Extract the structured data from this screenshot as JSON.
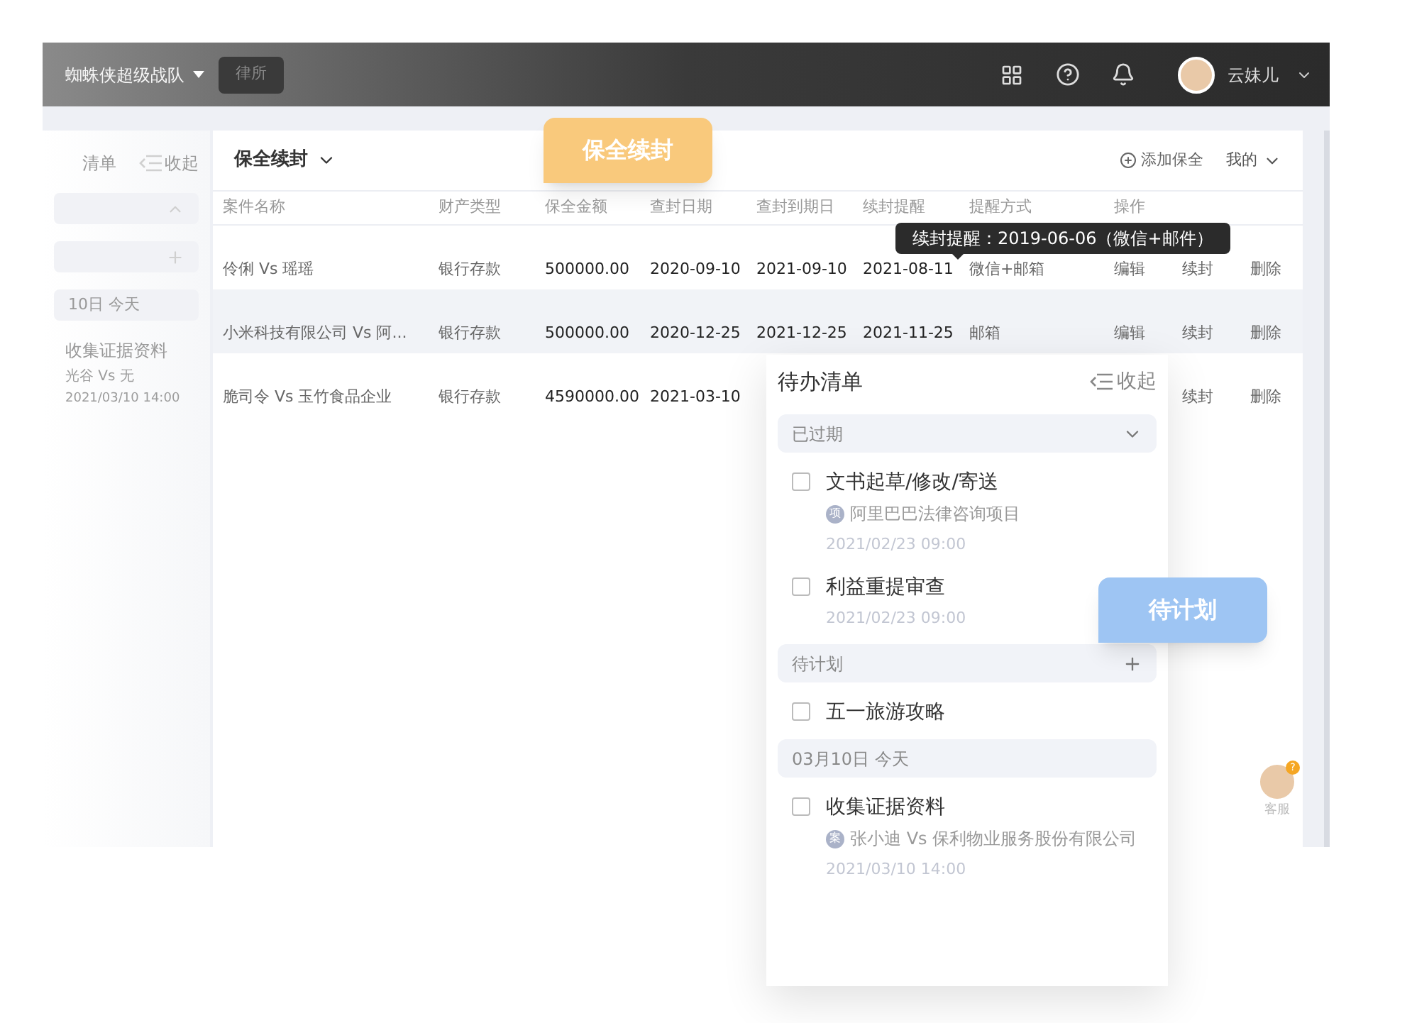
{
  "header": {
    "team": "蜘蛛侠超级战队",
    "team_tab": "律所",
    "user": "云妹儿"
  },
  "sidebar": {
    "title": "清单",
    "collapse": "收起",
    "sections": [
      {
        "kind": "expanded"
      },
      {
        "kind": "add"
      },
      {
        "kind": "plain",
        "label": "10日 今天"
      }
    ],
    "item": {
      "title": "收集证据资料",
      "project": "光谷 Vs 无",
      "time": "2021/03/10 14:00"
    }
  },
  "main": {
    "title": "保全续封",
    "add": "添加保全",
    "filter": "我的",
    "columns": [
      "案件名称",
      "财产类型",
      "保全金额",
      "查封日期",
      "查封到期日",
      "续封提醒",
      "提醒方式",
      "操作"
    ],
    "rows": [
      {
        "hovered": false,
        "cells": [
          "伶俐 Vs 瑶瑶",
          "银行存款",
          "500000.00",
          "2020-09-10",
          "2021-09-10",
          "2021-08-11",
          "微信+邮箱"
        ],
        "actions": [
          "编辑",
          "续封",
          "删除"
        ]
      },
      {
        "hovered": true,
        "cells": [
          "小米科技有限公司 Vs 阿...",
          "银行存款",
          "500000.00",
          "2020-12-25",
          "2021-12-25",
          "2021-11-25",
          "邮箱"
        ],
        "actions": [
          "编辑",
          "续封",
          "删除"
        ]
      },
      {
        "hovered": false,
        "cells": [
          "脆司令 Vs 玉竹食品企业",
          "银行存款",
          "4590000.00",
          "2021-03-10"
        ],
        "actions": [
          "续封",
          "删除"
        ]
      }
    ],
    "tooltip": "续封提醒：2019-06-06（微信+邮件）"
  },
  "todo": {
    "title": "待办清单",
    "collapse": "收起",
    "sections": [
      {
        "kind": "expanded",
        "label": "已过期",
        "items": [
          {
            "title": "文书起草/修改/寄送",
            "checked": false,
            "badge": "项",
            "project": "阿里巴巴法律咨询项目",
            "time": "2021/02/23 09:00"
          },
          {
            "title": "利益重提审查",
            "checked": false,
            "time": "2021/02/23 09:00"
          }
        ]
      },
      {
        "kind": "add",
        "label": "待计划",
        "items": [
          {
            "title": "五一旅游攻略",
            "checked": false
          }
        ]
      },
      {
        "kind": "plain",
        "label": "03月10日 今天",
        "items": [
          {
            "title": "收集证据资料",
            "checked": false,
            "badge": "案",
            "project": "张小迪 Vs 保利物业服务股份有限公司",
            "time": "2021/03/10 14:00"
          }
        ]
      }
    ]
  },
  "callouts": [
    {
      "text": "保全续封",
      "color": "#f9c97c"
    },
    {
      "text": "待计划",
      "color": "#9ec5f3"
    }
  ],
  "support": {
    "label": "客服",
    "badge": "?"
  }
}
